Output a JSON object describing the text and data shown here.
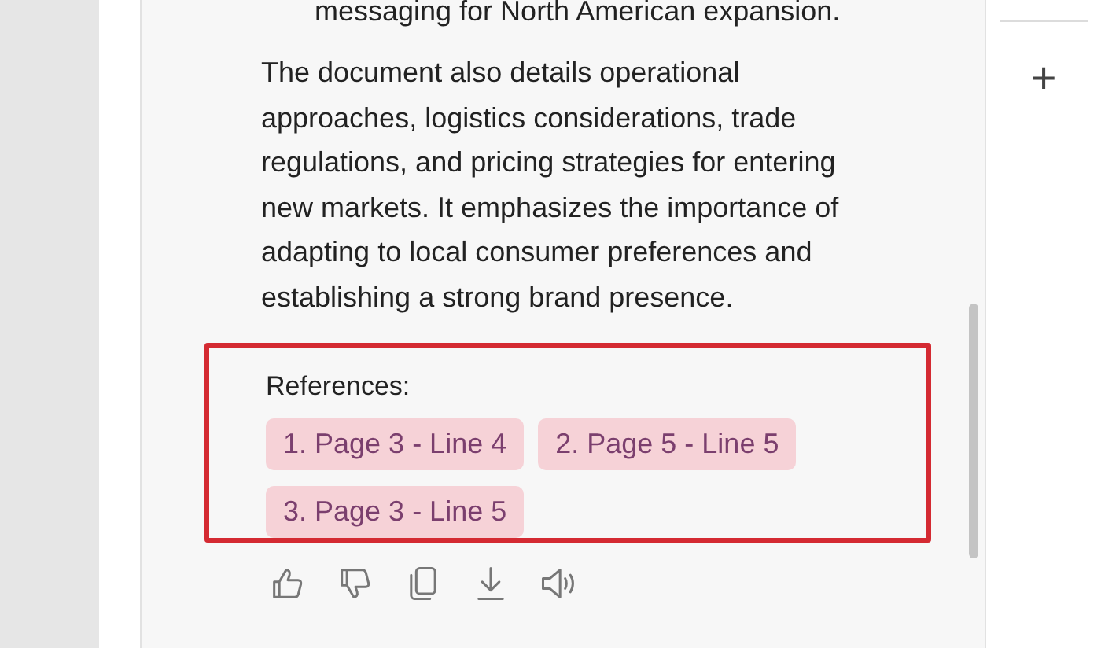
{
  "message": {
    "list_item_tail": "messaging for North American expansion.",
    "paragraph": "The document also details operational approaches, logistics considerations, trade regulations, and pricing strategies for entering new markets. It emphasizes the importance of adapting to local consumer preferences and establishing a strong brand presence.",
    "references_label": "References:",
    "references": [
      "1. Page 3 - Line 4",
      "2. Page 5 - Line 5",
      "3. Page 3 - Line 5"
    ],
    "highlighted": true
  },
  "actions": [
    {
      "kind": "like"
    },
    {
      "kind": "dislike"
    },
    {
      "kind": "copy"
    },
    {
      "kind": "download"
    },
    {
      "kind": "speak"
    }
  ],
  "side_panel": {
    "add_button": "+"
  }
}
